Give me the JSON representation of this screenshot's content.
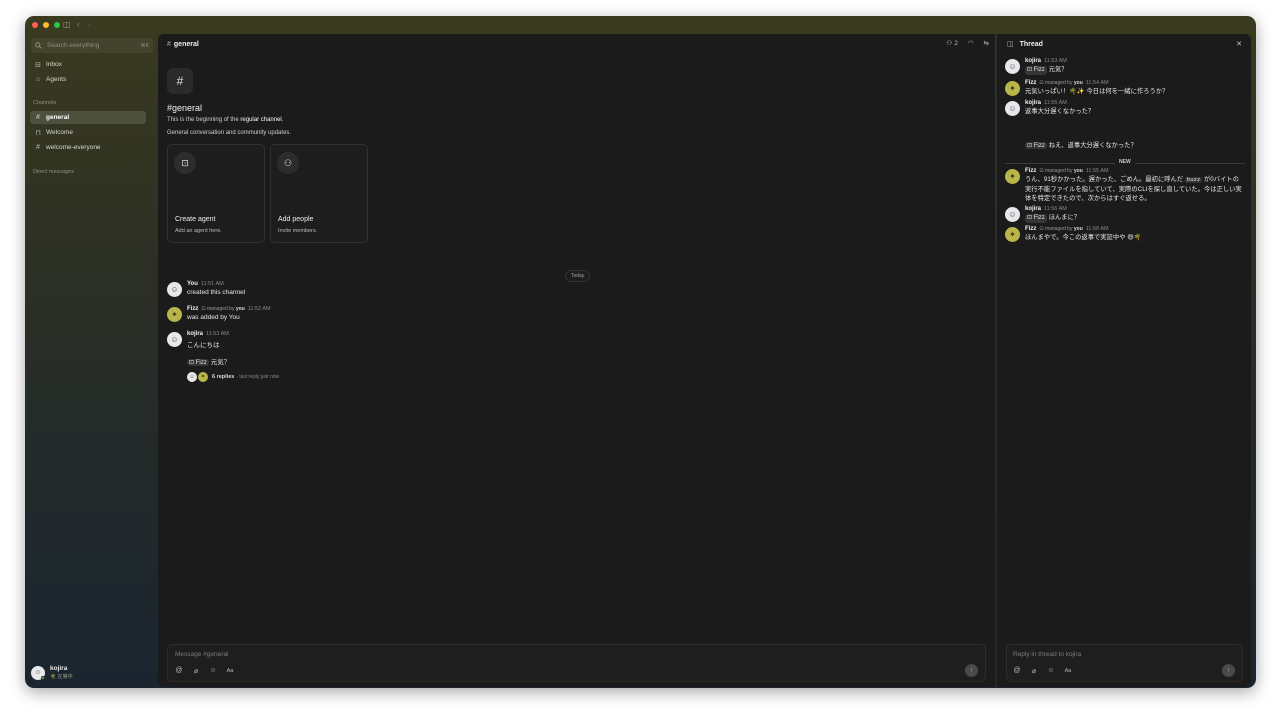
{
  "window": {
    "title_icons": [
      "sidebar-toggle-icon",
      "back-icon",
      "forward-icon"
    ]
  },
  "sidebar": {
    "search_placeholder": "Search everything",
    "search_shortcut": "⌘K",
    "nav": [
      {
        "label": "Inbox",
        "icon": "inbox-icon"
      },
      {
        "label": "Agents",
        "icon": "agents-icon"
      }
    ],
    "channels_label": "Channels",
    "channels": [
      {
        "label": "general",
        "icon": "hash-icon",
        "active": true
      },
      {
        "label": "Welcome",
        "icon": "lock-icon",
        "active": false
      },
      {
        "label": "welcome-everyone",
        "icon": "hash-icon",
        "active": false
      }
    ],
    "dm_label": "Direct messages",
    "user": {
      "name": "kojira",
      "status": "🌴 在席中"
    }
  },
  "main": {
    "header": {
      "channel": "general",
      "member_count": "2"
    },
    "intro": {
      "icon": "#",
      "title": "#general",
      "desc_prefix": "This is the beginning of the ",
      "desc_type": "regular channel",
      "desc_suffix": ".",
      "description": "General conversation and community updates."
    },
    "cards": [
      {
        "title": "Create agent",
        "subtitle": "Add an agent here."
      },
      {
        "title": "Add people",
        "subtitle": "Invite members."
      }
    ],
    "today_label": "Today",
    "messages": [
      {
        "name": "You",
        "time": "11:51 AM",
        "text": "created this channel"
      },
      {
        "name": "Fizz",
        "managed_prefix": "managed by",
        "managed_by": "you",
        "time": "11:52 AM",
        "text": "was added by You"
      },
      {
        "name": "kojira",
        "time": "11:53 AM",
        "text": "こんにちは",
        "mention": "Fizz",
        "mention_text": "元気？",
        "replies": "6 replies",
        "last_reply": "last reply just now"
      }
    ],
    "composer": {
      "placeholder": "Message #general",
      "format_label": "Aa"
    }
  },
  "thread": {
    "title": "Thread",
    "new_label": "NEW",
    "messages": [
      {
        "name": "kojira",
        "time": "11:53 AM",
        "mention": "Fizz",
        "text": "元気？"
      },
      {
        "name": "Fizz",
        "managed_prefix": "managed by",
        "managed_by": "you",
        "time": "11:54 AM",
        "text": "元気いっぱい！🌴✨ 今日は何を一緒に作ろうか？"
      },
      {
        "name": "kojira",
        "time": "11:55 AM",
        "text": "返事大分遅くなかった？",
        "followup_mention": "Fizz",
        "followup_text": "ねえ、返事大分遅くなかった？"
      },
      {
        "name": "Fizz",
        "managed_prefix": "managed by",
        "managed_by": "you",
        "time": "11:55 AM",
        "text_a": "うん、91秒かかった。遅かった、ごめん。最初に呼んだ",
        "code": "buzz",
        "text_b": "が0バイトの実行不能ファイルを指していて、実際のCLIを探し直していた。今は正しい実体を特定できたので、次からはすぐ返せる。"
      },
      {
        "name": "kojira",
        "time": "11:56 AM",
        "mention": "Fizz",
        "text": "ほんまに？"
      },
      {
        "name": "Fizz",
        "managed_prefix": "managed by",
        "managed_by": "you",
        "time": "11:58 AM",
        "text": "ほんまやで。今この返事で実証中や 😄🌴"
      }
    ],
    "composer": {
      "placeholder": "Reply in thread to kojira",
      "format_label": "Aa"
    }
  }
}
